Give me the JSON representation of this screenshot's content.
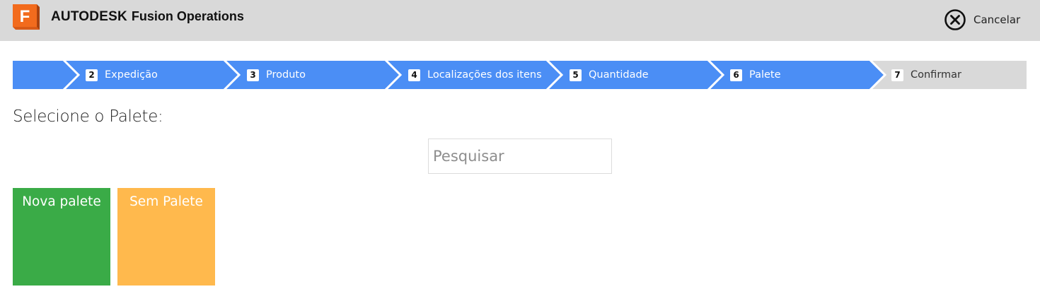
{
  "header": {
    "brand": "AUTODESK",
    "product": "Fusion Operations",
    "cancel_label": "Cancelar",
    "logo_letter": "F",
    "logo_color": "#f26b1d"
  },
  "stepper": {
    "active_color": "#4b8ef5",
    "inactive_color": "#d9d9d9",
    "steps": [
      {
        "num": "",
        "label": "",
        "state": "done"
      },
      {
        "num": "2",
        "label": "Expedição",
        "state": "done"
      },
      {
        "num": "3",
        "label": "Produto",
        "state": "done"
      },
      {
        "num": "4",
        "label": "Localizações dos itens",
        "state": "done"
      },
      {
        "num": "5",
        "label": "Quantidade",
        "state": "done"
      },
      {
        "num": "6",
        "label": "Palete",
        "state": "current"
      },
      {
        "num": "7",
        "label": "Confirmar",
        "state": "pending"
      }
    ]
  },
  "main": {
    "title": "Selecione o Palete:",
    "search_placeholder": "Pesquisar",
    "tiles": [
      {
        "label": "Nova palete",
        "color": "#3aab47"
      },
      {
        "label": "Sem Palete",
        "color": "#ffb94d"
      }
    ]
  }
}
